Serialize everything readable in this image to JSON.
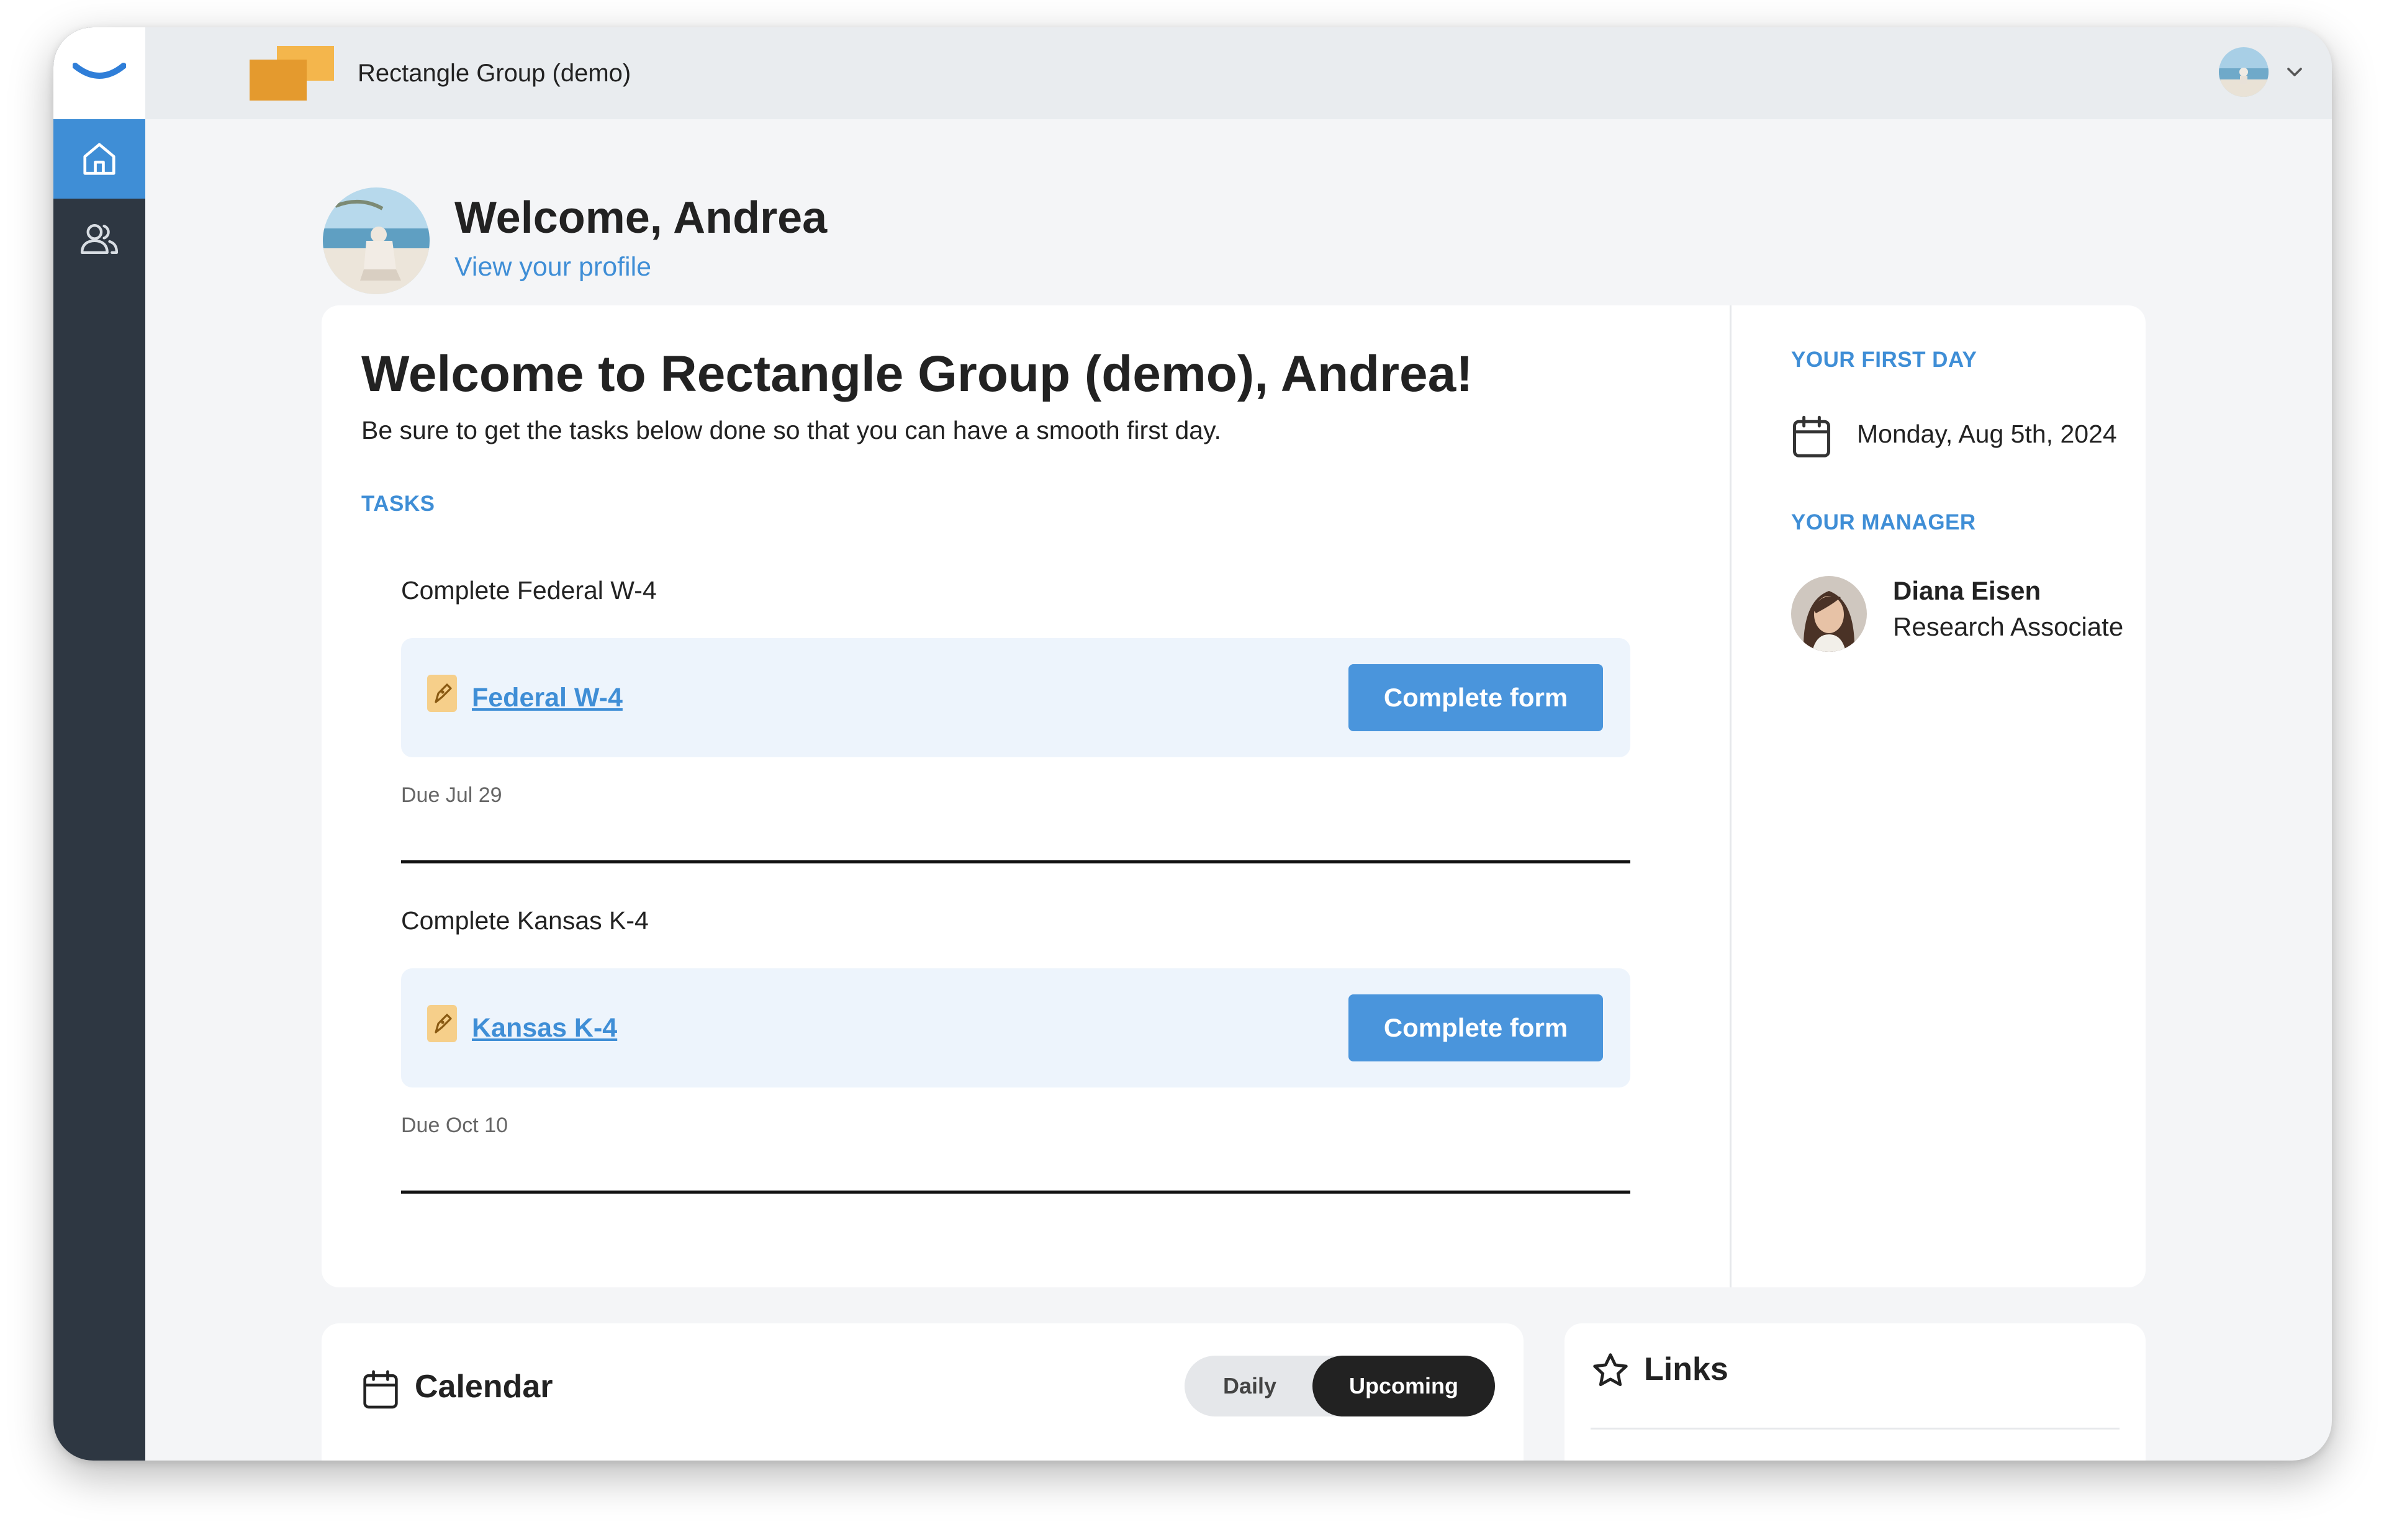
{
  "app": {
    "company_name": "Rectangle Group (demo)"
  },
  "sidebar": {
    "items": [
      {
        "icon": "home-icon",
        "label": "Home",
        "active": true
      },
      {
        "icon": "people-icon",
        "label": "People",
        "active": false
      }
    ]
  },
  "profile": {
    "welcome": "Welcome, Andrea",
    "view_profile": "View your profile"
  },
  "onboarding": {
    "title": "Welcome to Rectangle Group (demo), Andrea!",
    "subtitle": "Be sure to get the tasks below done so that you can have a smooth first day.",
    "tasks_label": "TASKS",
    "tasks": [
      {
        "title": "Complete Federal W-4",
        "form": "Federal W-4",
        "button": "Complete form",
        "due": "Due Jul 29"
      },
      {
        "title": "Complete Kansas K-4",
        "form": "Kansas K-4",
        "button": "Complete form",
        "due": "Due Oct 10"
      }
    ]
  },
  "side": {
    "first_day_label": "YOUR FIRST DAY",
    "first_day": "Monday, Aug 5th, 2024",
    "manager_label": "YOUR MANAGER",
    "manager_name": "Diana Eisen",
    "manager_role": "Research Associate"
  },
  "calendar": {
    "title": "Calendar",
    "toggle": [
      "Daily",
      "Upcoming"
    ],
    "selected": "Upcoming"
  },
  "links": {
    "title": "Links"
  },
  "colors": {
    "accent": "#3f8ed6",
    "sidebar": "#2e3742",
    "task_bg": "#edf4fc",
    "button": "#4a95dc"
  }
}
